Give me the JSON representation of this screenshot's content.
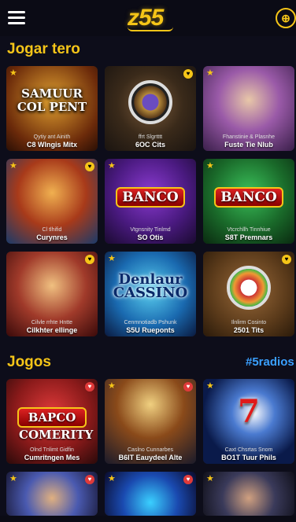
{
  "header": {
    "logo": "z55",
    "menu_icon": "hamburger-icon",
    "lang_icon": "globe-icon"
  },
  "sections": {
    "featured": {
      "title": "Jogar tero"
    },
    "games": {
      "title": "Jogos",
      "link": "#5radios"
    }
  },
  "colors": {
    "accent": "#f5c518",
    "link": "#3aa0ff",
    "background": "#0d0d1a"
  },
  "featured_cards": [
    {
      "title": "SAMUUR COL PENT",
      "small": "Qytiy ant Ainith",
      "caption": "C8 Wlngis Mitx"
    },
    {
      "title": "",
      "small": "ffrt Slgrtttt",
      "caption": "6OC Cits"
    },
    {
      "title": "",
      "small": "Fhanstinie & Plasnhe",
      "caption": "Fuste Tie Nlub"
    },
    {
      "title": "",
      "small": "Cl tlhifid",
      "caption": "Curynres"
    },
    {
      "title": "BANCO",
      "small": "Vtgnsnity Tinlmd",
      "caption": "SO Otis"
    },
    {
      "title": "BANCO",
      "small": "Vtcrchllh Tinnhiue",
      "caption": "S8T Premnars"
    },
    {
      "title": "",
      "small": "Cilvle rrhte Hntte",
      "caption": "Cilkhter ellinge"
    },
    {
      "title": "Denlaur CASSINO",
      "small": "Cenmnotiadb Pshunk",
      "caption": "S5U Rueponts"
    },
    {
      "title": "",
      "small": "Ilnlirm Cosinto",
      "caption": "2501 Tits"
    }
  ],
  "game_cards": [
    {
      "title": "BAPCO COMERITY",
      "small": "Olnd Tnlimt Gidfin",
      "caption": "Cumritngen Mes"
    },
    {
      "title": "",
      "small": "Caslno Cunnarbes",
      "caption": "B6IT Eauydeel Alte"
    },
    {
      "title": "",
      "small": "Caxt Chsrtas Snom",
      "caption": "BO1T Tuur Phils"
    }
  ]
}
